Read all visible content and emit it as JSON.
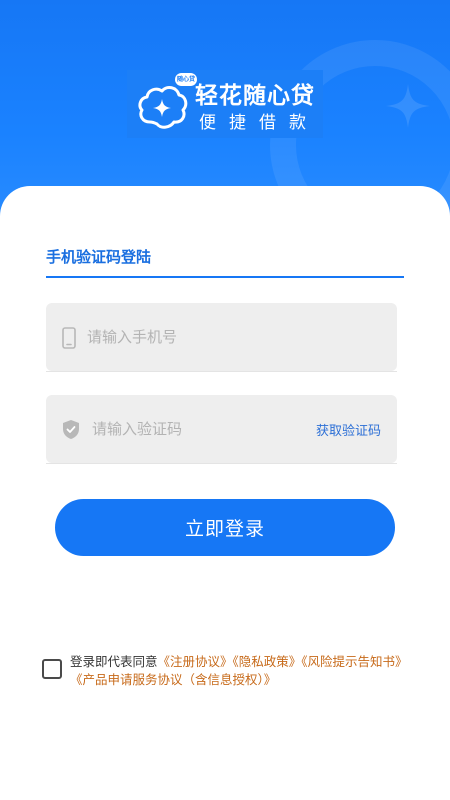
{
  "brand": {
    "badge": "随心贷",
    "title": "轻花随心贷",
    "subtitle": "便捷借款"
  },
  "login": {
    "tab_label": "手机验证码登陆",
    "phone_placeholder": "请输入手机号",
    "code_placeholder": "请输入验证码",
    "get_code_label": "获取验证码",
    "submit_label": "立即登录"
  },
  "agreement": {
    "prefix": "登录即代表同意",
    "links": [
      "《注册协议》",
      "《隐私政策》",
      "《风险提示告知书》",
      "《产品申请服务协议（含信息授权）》"
    ]
  },
  "colors": {
    "primary": "#1677f5",
    "link": "#c76a1a"
  },
  "icons": {
    "logo": "cloud-sparkle-icon",
    "phone": "phone-icon",
    "code": "shield-icon",
    "checkbox": "checkbox-icon"
  }
}
